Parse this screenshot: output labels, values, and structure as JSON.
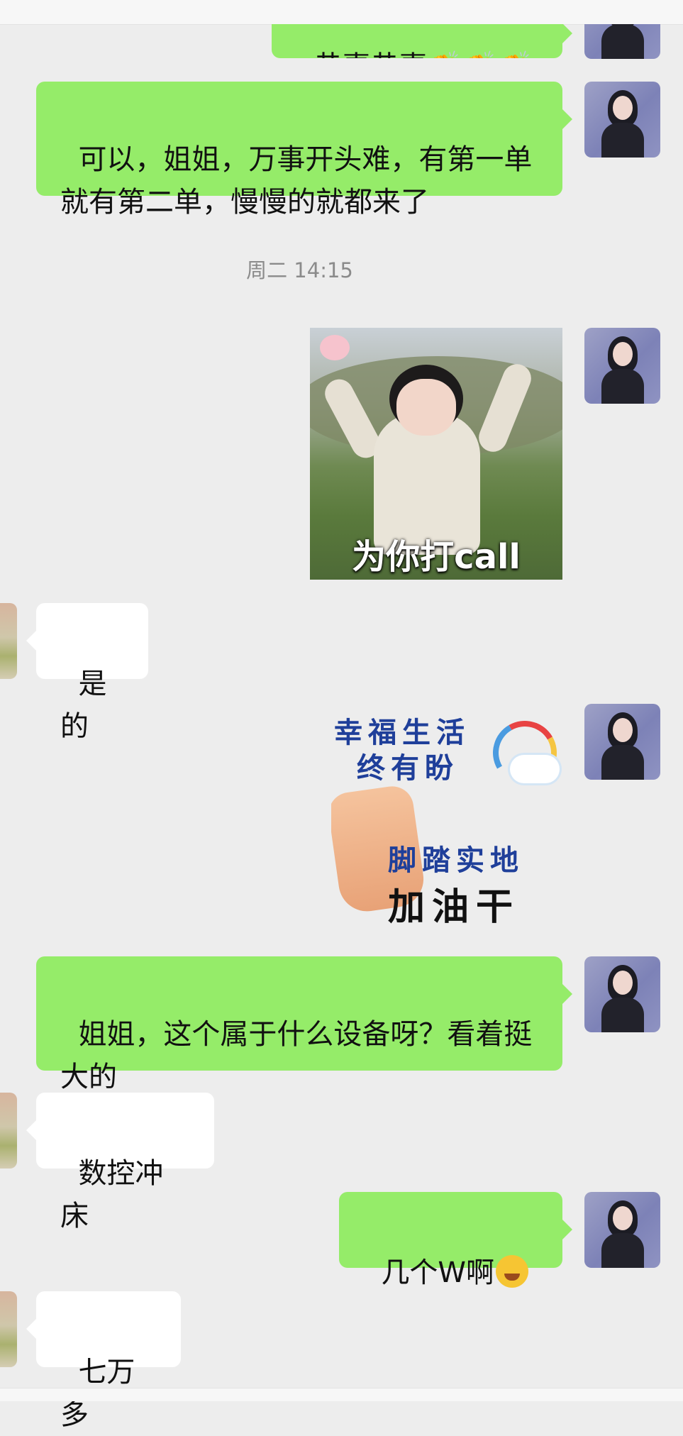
{
  "messages": [
    {
      "id": 0,
      "side": "right",
      "type": "text",
      "text": "恭喜恭喜👏👏👏"
    },
    {
      "id": 1,
      "side": "right",
      "type": "text",
      "text": "可以，姐姐，万事开头难，有第一单就有第二单，慢慢的就都来了"
    },
    {
      "id": 2,
      "type": "timestamp",
      "text": "周二 14:15"
    },
    {
      "id": 3,
      "side": "right",
      "type": "sticker",
      "caption": "为你打call"
    },
    {
      "id": 4,
      "side": "left",
      "type": "text",
      "text": "是的"
    },
    {
      "id": 5,
      "side": "right",
      "type": "sticker",
      "lines": [
        "幸福生活",
        "终有盼",
        "脚踏实地",
        "加油干"
      ]
    },
    {
      "id": 6,
      "side": "right",
      "type": "text",
      "text": "姐姐，这个属于什么设备呀？看着挺大的"
    },
    {
      "id": 7,
      "side": "left",
      "type": "text",
      "text": "数控冲床"
    },
    {
      "id": 8,
      "side": "right",
      "type": "text",
      "text": "几个W啊",
      "emoji": "facepalm-laugh"
    },
    {
      "id": 9,
      "side": "left",
      "type": "text",
      "text": "七万多"
    }
  ],
  "colors": {
    "background": "#ededed",
    "bubble_self": "#95ec69",
    "bubble_other": "#ffffff",
    "timestamp": "#8b8b8b"
  }
}
